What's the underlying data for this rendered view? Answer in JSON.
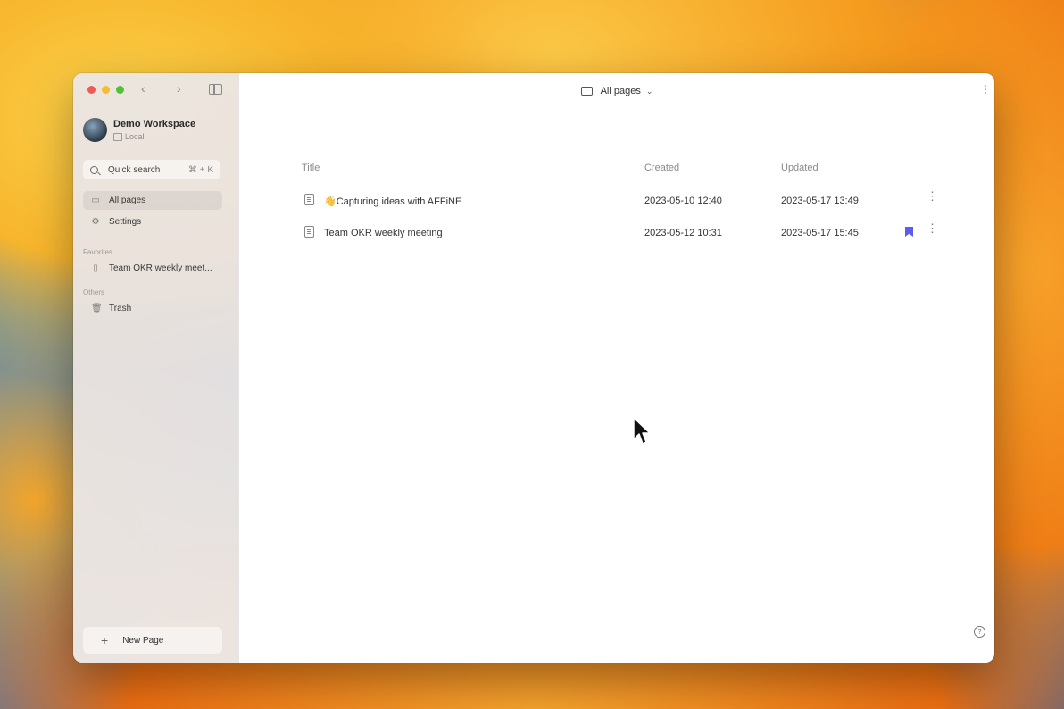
{
  "window": {
    "traffic_lights": [
      "close",
      "minimize",
      "maximize"
    ]
  },
  "sidebar": {
    "workspace": {
      "name": "Demo Workspace",
      "subtitle": "Local"
    },
    "quick_search": {
      "label": "Quick search",
      "shortcut": "⌘ + K"
    },
    "items": [
      {
        "label": "All pages",
        "icon": "folder-icon",
        "active": true
      },
      {
        "label": "Settings",
        "icon": "gear-icon",
        "active": false
      }
    ],
    "favorites": {
      "label": "Favorites",
      "items": [
        {
          "label": "Team OKR weekly meet...",
          "icon": "page-icon"
        }
      ]
    },
    "others": {
      "label": "Others",
      "items": [
        {
          "label": "Trash",
          "icon": "trash-icon"
        }
      ]
    },
    "new_page": {
      "label": "New Page"
    }
  },
  "main": {
    "header": {
      "title": "All pages"
    },
    "table": {
      "headers": {
        "title": "Title",
        "created": "Created",
        "updated": "Updated"
      },
      "rows": [
        {
          "title": "👋Capturing ideas with AFFiNE",
          "created": "2023-05-10 12:40",
          "updated": "2023-05-17 13:49",
          "favorite": false
        },
        {
          "title": "Team OKR weekly meeting",
          "created": "2023-05-12 10:31",
          "updated": "2023-05-17 15:45",
          "favorite": true
        }
      ]
    }
  },
  "colors": {
    "bookmark": "#5b5cf0",
    "close": "#ee5b55",
    "minimize": "#f5bd2f",
    "maximize": "#4fc23a"
  }
}
